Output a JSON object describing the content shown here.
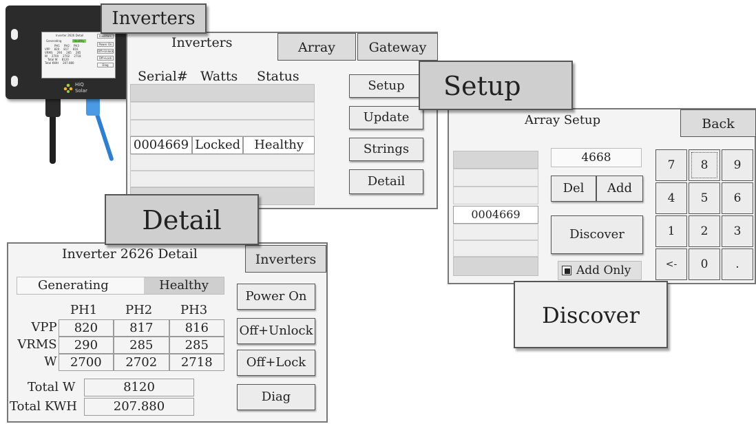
{
  "device": {
    "mini": {
      "title": "Inverter 2626 Detail",
      "inv_tab": "Inverters",
      "status_left": "Generating",
      "status_right": "Healthy",
      "head": [
        "PH1",
        "PH2",
        "PH3"
      ],
      "rows": [
        [
          "VPP",
          "820",
          "817",
          "816"
        ],
        [
          "VRMS",
          "290",
          "285",
          "285"
        ],
        [
          "W",
          "2700",
          "2702",
          "2718"
        ]
      ],
      "total_w": "Total W",
      "total_w_val": "8120",
      "total_kwh": "Total KWH",
      "total_kwh_val": "207.880",
      "buttons": [
        "Power On",
        "Off+Unlock",
        "Off+Lock",
        "Diag"
      ]
    },
    "brand": "HiQ",
    "brand_sub": "Solar"
  },
  "labels": {
    "inverters": "Inverters",
    "setup": "Setup",
    "detail": "Detail",
    "discover": "Discover"
  },
  "inverters_screen": {
    "tabs": {
      "inverters": "Inverters",
      "array": "Array",
      "gateway": "Gateway"
    },
    "columns": [
      "Serial#",
      "Watts",
      "Status"
    ],
    "row": {
      "serial": "0004669",
      "watts": "Locked",
      "status": "Healthy"
    },
    "buttons": {
      "setup": "Setup",
      "update": "Update",
      "strings": "Strings",
      "detail": "Detail"
    }
  },
  "setup_screen": {
    "title": "Array Setup",
    "back": "Back",
    "entry": "4668",
    "del": "Del",
    "add": "Add",
    "discover": "Discover",
    "add_only": "Add Only",
    "list_item": "0004669",
    "keys": [
      "7",
      "8",
      "9",
      "4",
      "5",
      "6",
      "1",
      "2",
      "3",
      "<-",
      "0",
      "."
    ]
  },
  "detail_screen": {
    "title": "Inverter 2626 Detail",
    "inv_tab": "Inverters",
    "status_left": "Generating",
    "status_right": "Healthy",
    "head": [
      "PH1",
      "PH2",
      "PH3"
    ],
    "rows": [
      {
        "label": "VPP",
        "v": [
          "820",
          "817",
          "816"
        ]
      },
      {
        "label": "VRMS",
        "v": [
          "290",
          "285",
          "285"
        ]
      },
      {
        "label": "W",
        "v": [
          "2700",
          "2702",
          "2718"
        ]
      }
    ],
    "total_w_label": "Total W",
    "total_w": "8120",
    "total_kwh_label": "Total KWH",
    "total_kwh": "207.880",
    "buttons": {
      "power_on": "Power On",
      "off_unlock": "Off+Unlock",
      "off_lock": "Off+Lock",
      "diag": "Diag"
    }
  }
}
